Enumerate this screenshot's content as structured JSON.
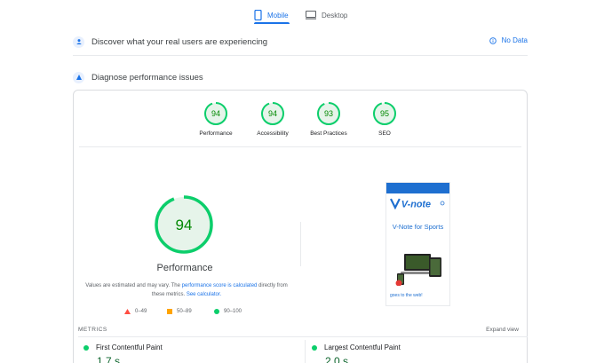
{
  "tabs": {
    "mobile": "Mobile",
    "desktop": "Desktop"
  },
  "field_section": {
    "title": "Discover what your real users are experiencing",
    "status": "No Data"
  },
  "lab_section": {
    "title": "Diagnose performance issues"
  },
  "scores": [
    {
      "label": "Performance",
      "value": "94"
    },
    {
      "label": "Accessibility",
      "value": "94"
    },
    {
      "label": "Best Practices",
      "value": "93"
    },
    {
      "label": "SEO",
      "value": "95"
    }
  ],
  "main_score": {
    "value": "94",
    "title": "Performance"
  },
  "note": {
    "part1": "Values are estimated and may vary. The ",
    "link1": "performance score is calculated",
    "part2": " directly from these metrics. ",
    "link2": "See calculator."
  },
  "legend": {
    "fail": "0–49",
    "average": "50–89",
    "pass": "90–100"
  },
  "screenshot": {
    "headline": "V-Note for Sports",
    "footer": "goes to the web!",
    "logo": "V-note"
  },
  "metrics": {
    "heading": "METRICS",
    "expand": "Expand view",
    "items": [
      {
        "label": "First Contentful Paint",
        "value": "1.7 s"
      },
      {
        "label": "Largest Contentful Paint",
        "value": "2.0 s"
      }
    ]
  },
  "colors": {
    "pass": "#0cce6b",
    "pass_bg": "#e6f4ea",
    "pass_text": "#008800",
    "accent": "#1a73e8",
    "fail": "#ff4e42",
    "average": "#ffa400"
  }
}
